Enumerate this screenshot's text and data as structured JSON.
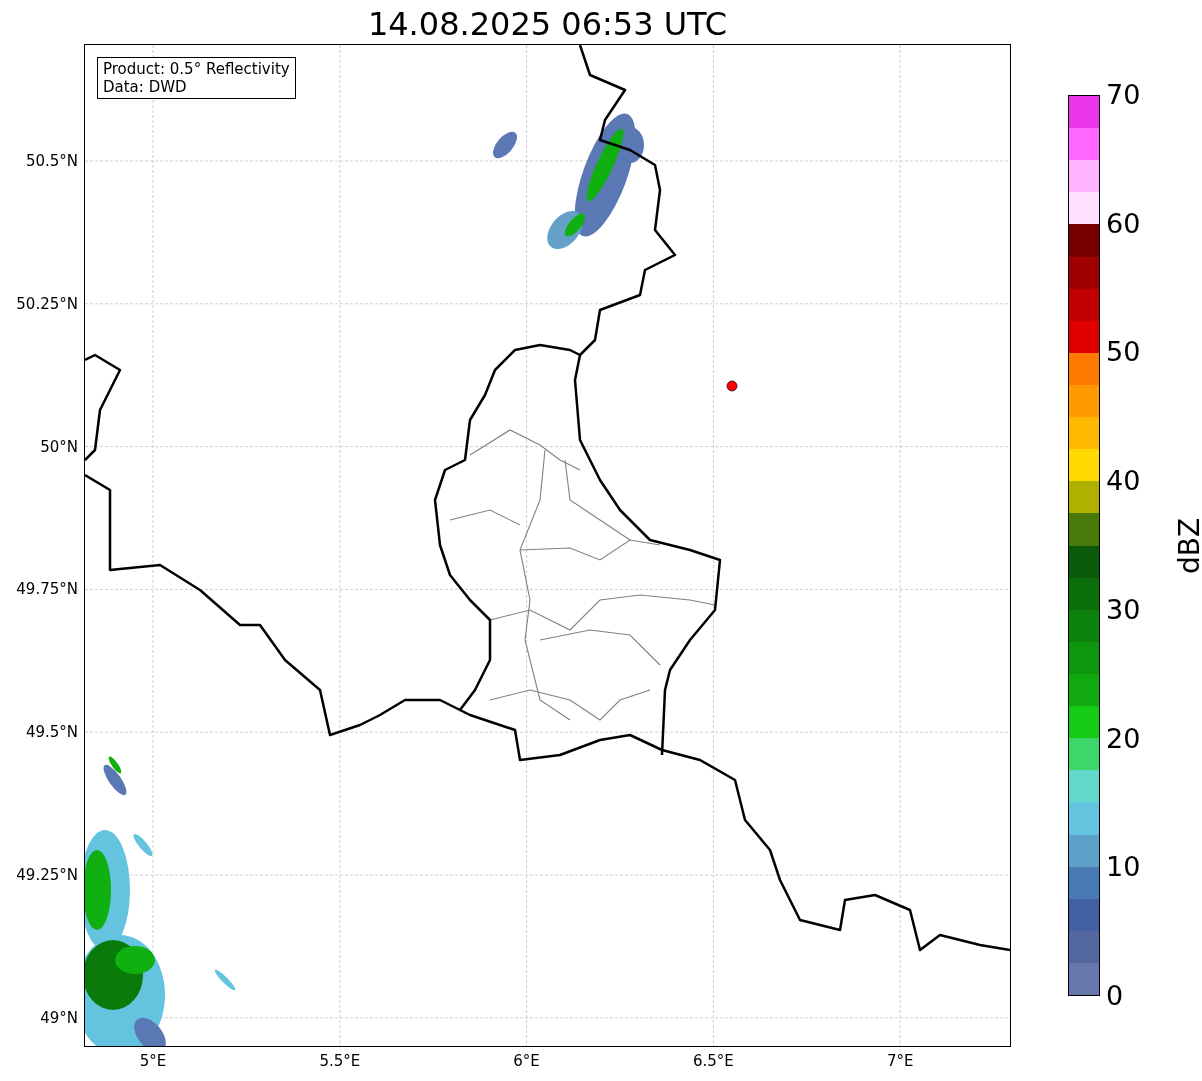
{
  "title": "14.08.2025 06:53 UTC",
  "info_box": {
    "lines": [
      "Product: 0.5° Reflectivity",
      "Data: DWD"
    ]
  },
  "x_tick_labels": [
    "5°E",
    "5.5°E",
    "6°E",
    "6.5°E",
    "7°E"
  ],
  "y_tick_labels": [
    "50.5°N",
    "50.25°N",
    "50°N",
    "49.75°N",
    "49.5°N",
    "49.25°N",
    "49°N"
  ],
  "colorbar": {
    "label": "dBZ",
    "tick_labels": [
      "70",
      "60",
      "50",
      "40",
      "30",
      "20",
      "10",
      "0"
    ],
    "segments": [
      {
        "color": "#e934e9"
      },
      {
        "color": "#ff66ff"
      },
      {
        "color": "#ffb3ff"
      },
      {
        "color": "#ffe0ff"
      },
      {
        "color": "#780000"
      },
      {
        "color": "#a00000"
      },
      {
        "color": "#c00000"
      },
      {
        "color": "#e00000"
      },
      {
        "color": "#ff7a00"
      },
      {
        "color": "#ff9a00"
      },
      {
        "color": "#ffb800"
      },
      {
        "color": "#ffd800"
      },
      {
        "color": "#b0b000"
      },
      {
        "color": "#4a7a0a"
      },
      {
        "color": "#0a5a0a"
      },
      {
        "color": "#0a6e0a"
      },
      {
        "color": "#0c820c"
      },
      {
        "color": "#0e960e"
      },
      {
        "color": "#10aa10"
      },
      {
        "color": "#14cc14"
      },
      {
        "color": "#3cd66a"
      },
      {
        "color": "#64d8c8"
      },
      {
        "color": "#64c4e0"
      },
      {
        "color": "#5aa0c8"
      },
      {
        "color": "#4a7ab4"
      },
      {
        "color": "#4460a4"
      },
      {
        "color": "#5468a0"
      },
      {
        "color": "#6878ac"
      }
    ]
  }
}
